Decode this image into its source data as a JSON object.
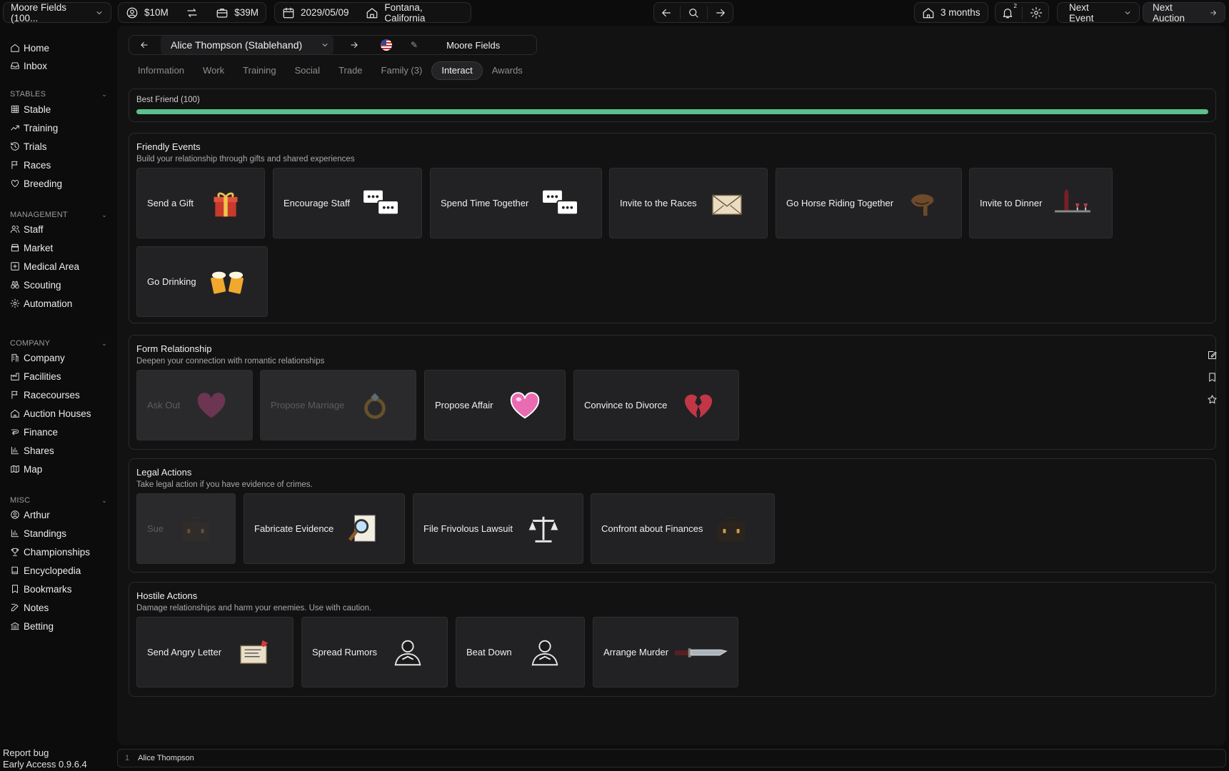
{
  "topbar": {
    "company": "Moore Fields (100...",
    "cash": "$10M",
    "assets": "$39M",
    "date": "2029/05/09",
    "location": "Fontana, California",
    "horizon": "3 months",
    "notif_count": "2",
    "next_event": "Next Event",
    "next_auction": "Next Auction"
  },
  "sidebar": {
    "top": [
      {
        "label": "Home",
        "icon": "home-icon"
      },
      {
        "label": "Inbox",
        "icon": "inbox-icon"
      }
    ],
    "sections": [
      {
        "title": "STABLES",
        "items": [
          "Stable",
          "Training",
          "Trials",
          "Races",
          "Breeding"
        ]
      },
      {
        "title": "MANAGEMENT",
        "items": [
          "Staff",
          "Market",
          "Medical Area",
          "Scouting",
          "Automation"
        ]
      },
      {
        "title": "COMPANY",
        "items": [
          "Company",
          "Facilities",
          "Racecourses",
          "Auction Houses",
          "Finance",
          "Shares",
          "Map"
        ]
      },
      {
        "title": "MISC",
        "items": [
          "Arthur",
          "Standings",
          "Championships",
          "Encyclopedia",
          "Bookmarks",
          "Notes",
          "Betting"
        ]
      }
    ],
    "footer": {
      "report": "Report bug",
      "version": "Early Access 0.9.6.4"
    }
  },
  "person": {
    "name": "Alice Thompson (Stablehand)",
    "employer": "Moore Fields"
  },
  "tabs": [
    "Information",
    "Work",
    "Training",
    "Social",
    "Trade",
    "Family (3)",
    "Interact",
    "Awards"
  ],
  "active_tab": "Interact",
  "relationship": {
    "label": "Best Friend (100)",
    "value": 100,
    "color": "#5cc08e"
  },
  "groups": [
    {
      "title": "Friendly Events",
      "subtitle": "Build your relationship through gifts and shared experiences",
      "actions": [
        "Send a Gift",
        "Encourage Staff",
        "Spend Time Together",
        "Invite to the Races",
        "Go Horse Riding Together",
        "Invite to Dinner",
        "Go Drinking"
      ]
    },
    {
      "title": "Form Relationship",
      "subtitle": "Deepen your connection with romantic relationships",
      "actions": [
        "Ask Out",
        "Propose Marriage",
        "Propose Affair",
        "Convince to Divorce"
      ]
    },
    {
      "title": "Legal Actions",
      "subtitle": "Take legal action if you have evidence of crimes.",
      "actions": [
        "Sue",
        "Fabricate Evidence",
        "File Frivolous Lawsuit",
        "Confront about Finances"
      ]
    },
    {
      "title": "Hostile Actions",
      "subtitle": "Damage relationships and harm your enemies. Use with caution.",
      "actions": [
        "Send Angry Letter",
        "Spread Rumors",
        "Beat Down",
        "Arrange Murder"
      ]
    }
  ],
  "bottom": {
    "index": "1",
    "name": "Alice Thompson"
  }
}
